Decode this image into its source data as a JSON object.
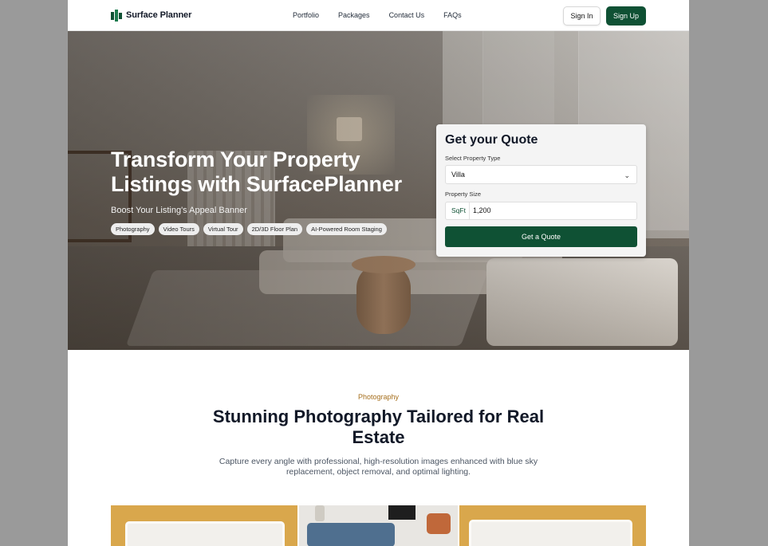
{
  "header": {
    "brand": "Surface Planner",
    "nav": [
      "Portfolio",
      "Packages",
      "Contact Us",
      "FAQs"
    ],
    "sign_in": "Sign In",
    "sign_up": "Sign Up",
    "brand_color": "#0f5134"
  },
  "hero": {
    "title": "Transform Your Property Listings with SurfacePlanner",
    "subtitle": "Boost Your Listing's Appeal Banner",
    "chips": [
      "Photography",
      "Video Tours",
      "Virtual Tour",
      "2D/3D Floor Plan",
      "AI-Powered Room Staging"
    ]
  },
  "quote": {
    "title": "Get your Quote",
    "property_type_label": "Select Property Type",
    "property_type_value": "Villa",
    "size_label": "Property Size",
    "size_unit": "SqFt",
    "size_value": "1,200",
    "button": "Get a Quote"
  },
  "section": {
    "eyebrow": "Photography",
    "title": "Stunning Photography Tailored for Real Estate",
    "description": "Capture every angle with professional, high-resolution images enhanced with blue sky replacement, object removal, and optimal lighting.",
    "accent_color": "#a66f1d"
  },
  "icons": {
    "select_chevron": "chevron-down-icon",
    "logo": "logo-icon"
  }
}
